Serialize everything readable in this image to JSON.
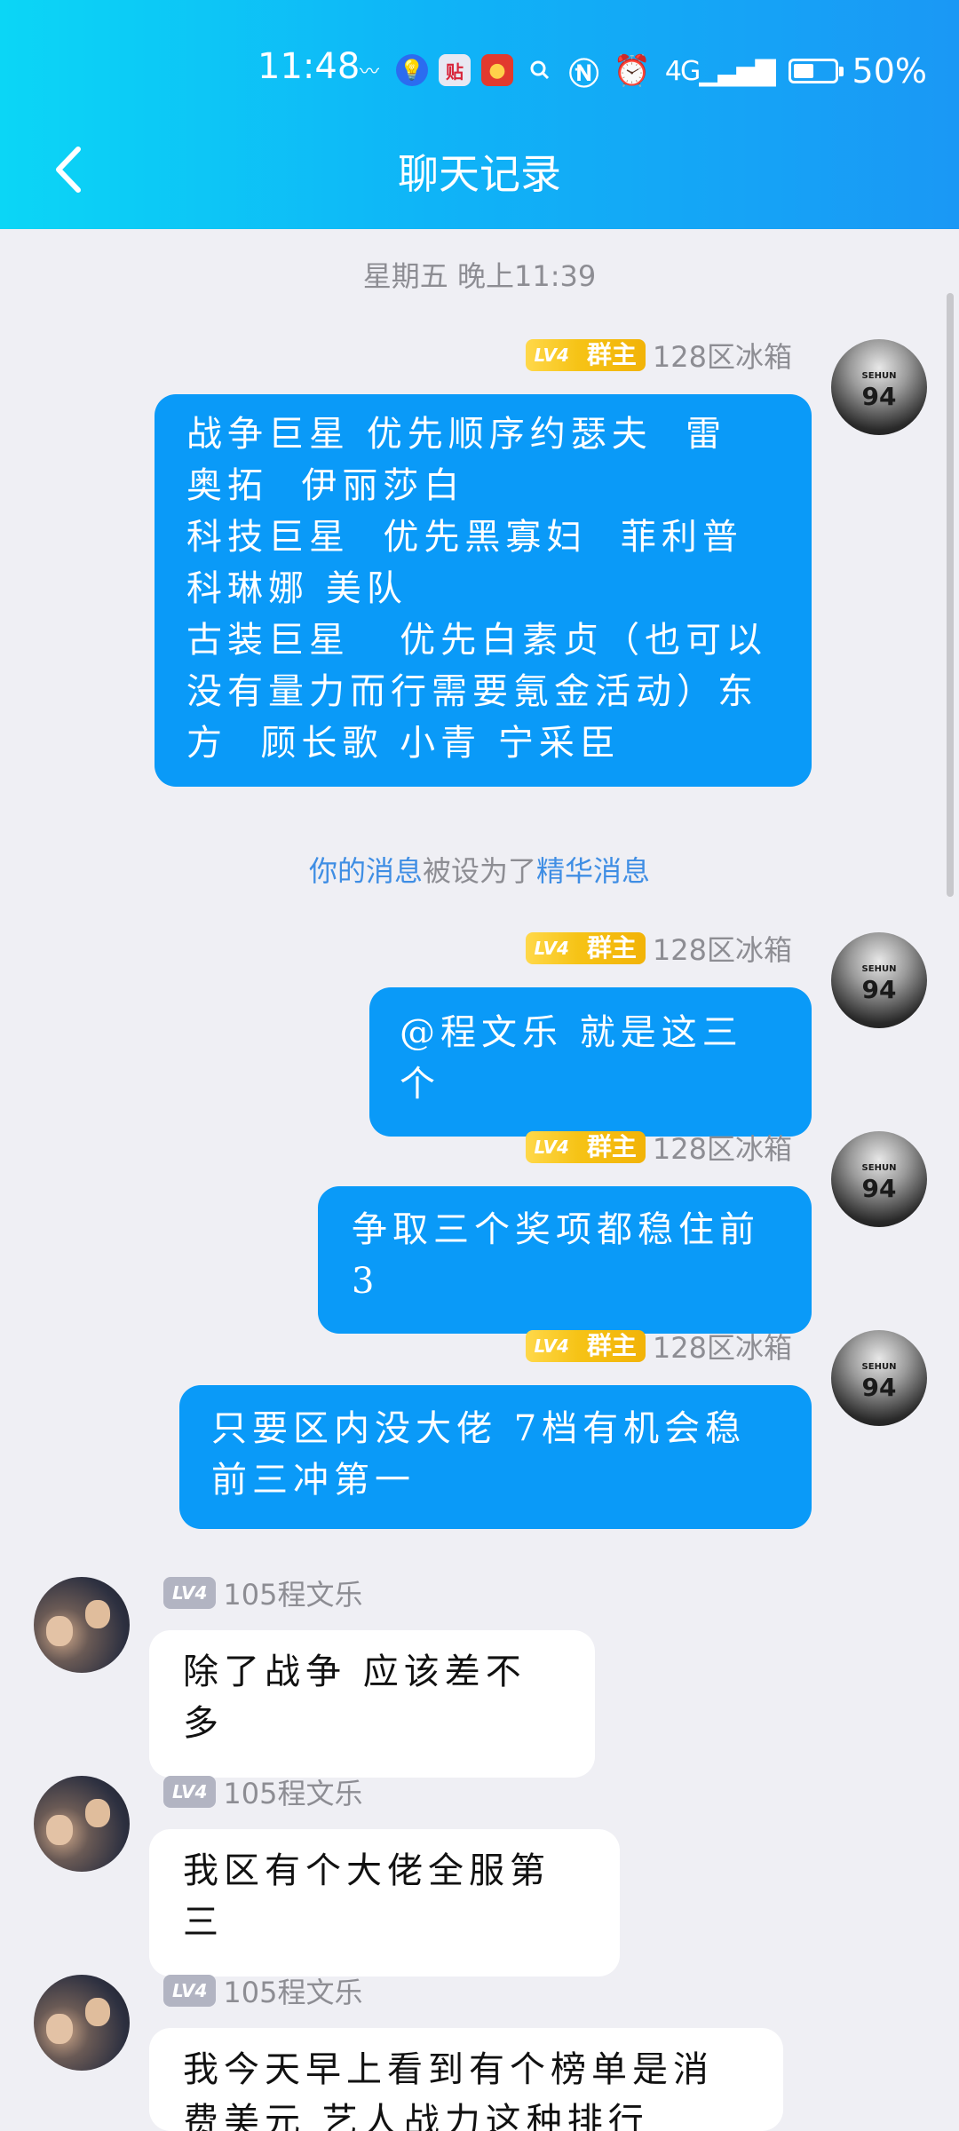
{
  "status_bar": {
    "time": "11:48",
    "battery": "50%",
    "battery_level": 0.5,
    "icons": [
      "swoosh-icon",
      "bulb-icon",
      "tieba-icon",
      "red-packet-icon",
      "search-icon",
      "more-icon"
    ],
    "right_icons": [
      "nfc-icon",
      "alarm-icon",
      "signal-4g-icon",
      "battery-icon"
    ]
  },
  "header": {
    "title": "聊天记录"
  },
  "messages": {
    "timestamp": "星期五 晚上11:39",
    "sender_me": "128区冰箱",
    "sender_friend": "105程文乐",
    "badge_level": "LV4",
    "badge_role": "群主",
    "m1": "战争巨星 优先顺序约瑟夫  雷 奥拓  伊丽莎白\n科技巨星  优先黑寡妇  菲利普 科琳娜 美队\n古装巨星   优先白素贞（也可以没有量力而行需要氪金活动）东方  顾长歌 小青 宁采臣",
    "notice_part1": "你的消息",
    "notice_part2": "被设为了",
    "notice_part3": "精华消息",
    "m2": "@程文乐 就是这三个",
    "m3": "争取三个奖项都稳住前3",
    "m4": "只要区内没大佬 7档有机会稳前三冲第一",
    "m5": "除了战争 应该差不多",
    "m6": "我区有个大佬全服第三",
    "m7": "我今天早上看到有个榜单是消费美元 艺人战力这种排行"
  }
}
